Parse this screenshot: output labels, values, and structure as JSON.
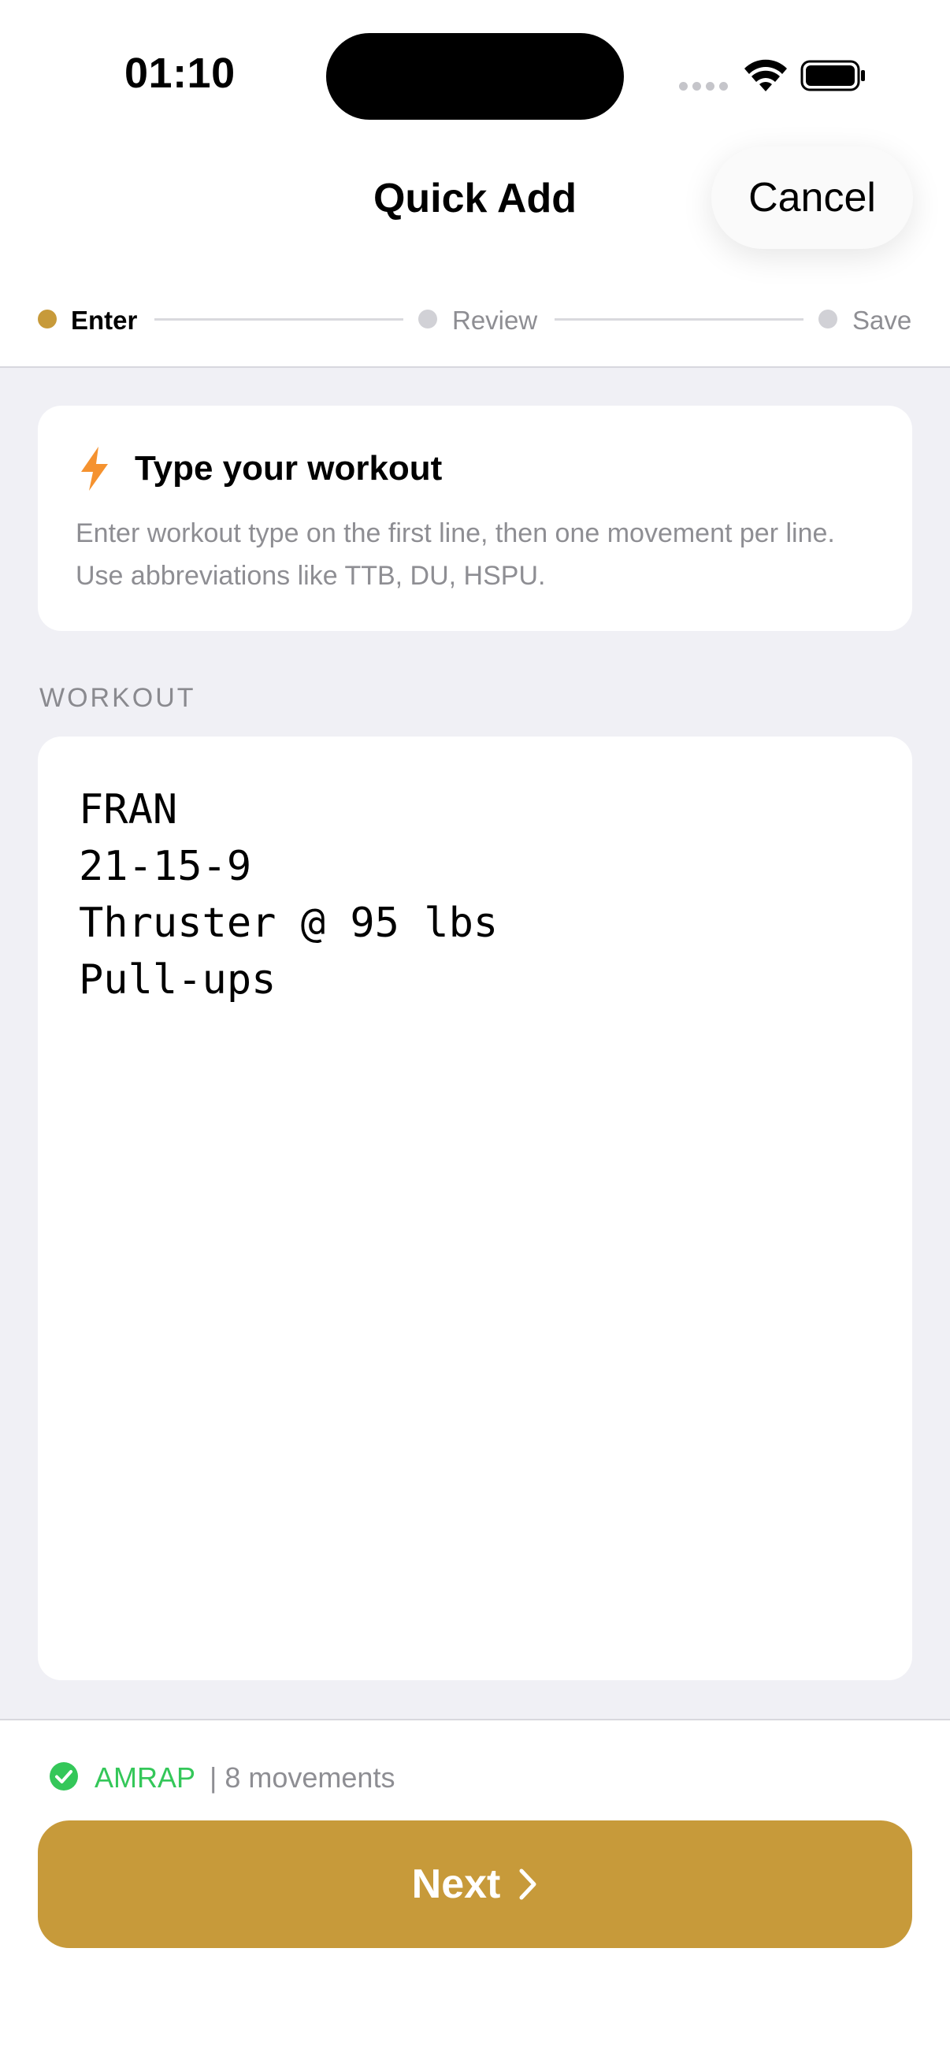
{
  "status_bar": {
    "time": "01:10"
  },
  "nav": {
    "title": "Quick Add",
    "cancel_label": "Cancel"
  },
  "stepper": {
    "steps": [
      {
        "label": "Enter",
        "state": "active"
      },
      {
        "label": "Review",
        "state": "pending"
      },
      {
        "label": "Save",
        "state": "pending"
      }
    ]
  },
  "info_card": {
    "icon": "bolt-icon",
    "title": "Type your workout",
    "description": "Enter workout type on the first line, then one movement per line. Use abbreviations like TTB, DU, HSPU."
  },
  "editor": {
    "section_label": "WORKOUT",
    "lines": [
      "FRAN",
      "21-15-9",
      "Thruster @ 95 lbs",
      "Pull-ups"
    ]
  },
  "summary": {
    "icon": "check-circle-icon",
    "type": "AMRAP",
    "count": "| 8 movements"
  },
  "next_button": {
    "label": "Next",
    "icon": "chevron-right-icon"
  },
  "colors": {
    "accent": "#c79a3a",
    "success": "#34c759",
    "bolt": "#f5922f",
    "background": "#f0f0f5"
  }
}
